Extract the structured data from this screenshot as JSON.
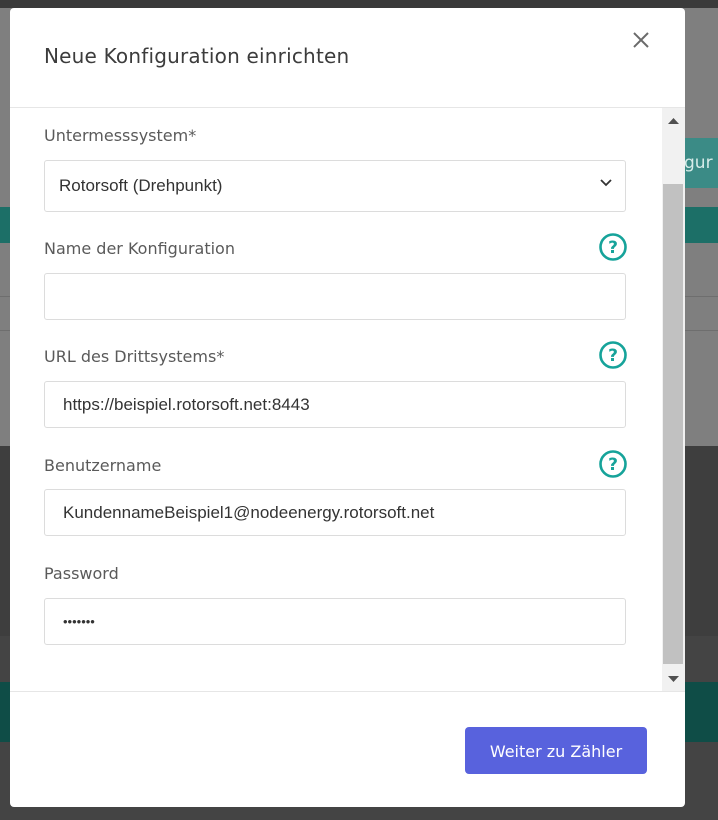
{
  "modal": {
    "title": "Neue Konfiguration einrichten",
    "close_icon": "close-icon"
  },
  "form": {
    "subsystem": {
      "label": "Untermesssystem*",
      "value": "Rotorsoft (Drehpunkt)"
    },
    "config_name": {
      "label": "Name der Konfiguration",
      "value": "",
      "help_icon": "help-icon"
    },
    "url": {
      "label": "URL des Drittsystems*",
      "value": "https://beispiel.rotorsoft.net:8443",
      "help_icon": "help-icon"
    },
    "username": {
      "label": "Benutzername",
      "value": "KundennameBeispiel1@nodeenergy.rotorsoft.net",
      "help_icon": "help-icon"
    },
    "password": {
      "label": "Password",
      "value": "•••••••"
    }
  },
  "footer": {
    "next_label": "Weiter zu Zähler"
  },
  "background": {
    "partial_button_text": "gur"
  },
  "colors": {
    "accent": "#5862dd",
    "help": "#16a39a",
    "teal_bar": "#1c6f67"
  }
}
